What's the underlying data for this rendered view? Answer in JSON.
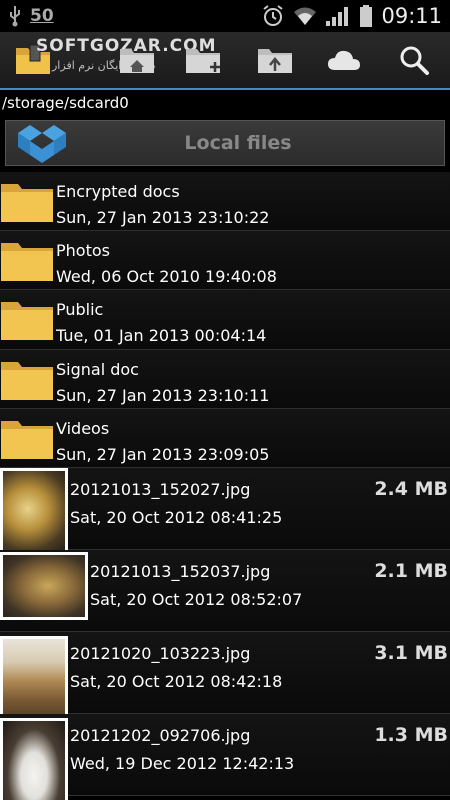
{
  "status": {
    "left_number": "50",
    "time": "09:11"
  },
  "watermark": {
    "text": "SOFTGOZAR.COM",
    "subtext": "دانلود رایگان نرم افزار"
  },
  "action_bar": {
    "icons": [
      "app-folder-icon",
      "home-folder-icon",
      "new-folder-icon",
      "upload-folder-icon",
      "cloud-icon",
      "search-icon"
    ]
  },
  "path": "/storage/sdcard0",
  "source": {
    "label": "Local files",
    "icon": "dropbox-icon"
  },
  "folders": [
    {
      "name": "Encrypted docs",
      "date": "Sun, 27 Jan 2013 23:10:22"
    },
    {
      "name": "Photos",
      "date": "Wed, 06 Oct 2010 19:40:08"
    },
    {
      "name": "Public",
      "date": "Tue, 01 Jan 2013 00:04:14"
    },
    {
      "name": "Signal doc",
      "date": "Sun, 27 Jan 2013 23:10:11"
    },
    {
      "name": "Videos",
      "date": "Sun, 27 Jan 2013 23:09:05"
    }
  ],
  "files": [
    {
      "name": "20121013_152027.jpg",
      "date": "Sat, 20 Oct 2012 08:41:25",
      "size": "2.4 MB"
    },
    {
      "name": "20121013_152037.jpg",
      "date": "Sat, 20 Oct 2012 08:52:07",
      "size": "2.1 MB"
    },
    {
      "name": "20121020_103223.jpg",
      "date": "Sat, 20 Oct 2012 08:42:18",
      "size": "3.1 MB"
    },
    {
      "name": "20121202_092706.jpg",
      "date": "Wed, 19 Dec 2012 12:42:13",
      "size": "1.3 MB"
    }
  ],
  "colors": {
    "accent": "#3a8fc8",
    "folder": "#f0c24a"
  }
}
